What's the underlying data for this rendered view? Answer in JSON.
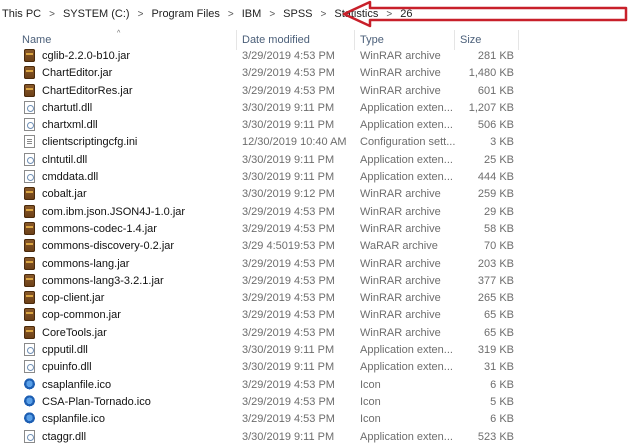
{
  "breadcrumb": [
    "This PC",
    "SYSTEM (C:)",
    "Program Files",
    "IBM",
    "SPSS",
    "Statistics",
    "26"
  ],
  "columns": {
    "name": "Name",
    "date": "Date modified",
    "type": "Type",
    "size": "Size"
  },
  "accent_color": "#c8202a",
  "files": [
    {
      "icon": "jar-file-icon",
      "name": "cglib-2.2.0-b10.jar",
      "date": "3/29/2019 4:53 PM",
      "type": "WinRAR archive",
      "size": "281 KB"
    },
    {
      "icon": "jar-file-icon",
      "name": "ChartEditor.jar",
      "date": "3/29/2019 4:53 PM",
      "type": "WinRAR archive",
      "size": "1,480 KB"
    },
    {
      "icon": "jar-file-icon",
      "name": "ChartEditorRes.jar",
      "date": "3/29/2019 4:53 PM",
      "type": "WinRAR archive",
      "size": "601 KB"
    },
    {
      "icon": "dll-file-icon",
      "name": "chartutl.dll",
      "date": "3/30/2019 9:11 PM",
      "type": "Application exten...",
      "size": "1,207 KB"
    },
    {
      "icon": "dll-file-icon",
      "name": "chartxml.dll",
      "date": "3/30/2019 9:11 PM",
      "type": "Application exten...",
      "size": "506 KB"
    },
    {
      "icon": "ini-file-icon",
      "name": "clientscriptingcfg.ini",
      "date": "12/30/2019 10:40 AM",
      "type": "Configuration sett...",
      "size": "3 KB"
    },
    {
      "icon": "dll-file-icon",
      "name": "clntutil.dll",
      "date": "3/30/2019 9:11 PM",
      "type": "Application exten...",
      "size": "25 KB"
    },
    {
      "icon": "dll-file-icon",
      "name": "cmddata.dll",
      "date": "3/30/2019 9:11 PM",
      "type": "Application exten...",
      "size": "444 KB"
    },
    {
      "icon": "jar-file-icon",
      "name": "cobalt.jar",
      "date": "3/30/2019 9:12 PM",
      "type": "WinRAR archive",
      "size": "259 KB"
    },
    {
      "icon": "jar-file-icon",
      "name": "com.ibm.json.JSON4J-1.0.jar",
      "date": "3/29/2019 4:53 PM",
      "type": "WinRAR archive",
      "size": "29 KB"
    },
    {
      "icon": "jar-file-icon",
      "name": "commons-codec-1.4.jar",
      "date": "3/29/2019 4:53 PM",
      "type": "WinRAR archive",
      "size": "58 KB"
    },
    {
      "icon": "jar-file-icon",
      "name": "commons-discovery-0.2.jar",
      "date": "3/29 4:5019:53 PM",
      "type": "WaRAR archive",
      "size": "70 KB"
    },
    {
      "icon": "jar-file-icon",
      "name": "commons-lang.jar",
      "date": "3/29/2019 4:53 PM",
      "type": "WinRAR archive",
      "size": "203 KB"
    },
    {
      "icon": "jar-file-icon",
      "name": "commons-lang3-3.2.1.jar",
      "date": "3/29/2019 4:53 PM",
      "type": "WinRAR archive",
      "size": "377 KB"
    },
    {
      "icon": "jar-file-icon",
      "name": "cop-client.jar",
      "date": "3/29/2019 4:53 PM",
      "type": "WinRAR archive",
      "size": "265 KB"
    },
    {
      "icon": "jar-file-icon",
      "name": "cop-common.jar",
      "date": "3/29/2019 4:53 PM",
      "type": "WinRAR archive",
      "size": "65 KB"
    },
    {
      "icon": "jar-file-icon",
      "name": "CoreTools.jar",
      "date": "3/29/2019 4:53 PM",
      "type": "WinRAR archive",
      "size": "65 KB"
    },
    {
      "icon": "dll-file-icon",
      "name": "cpputil.dll",
      "date": "3/30/2019 9:11 PM",
      "type": "Application exten...",
      "size": "319 KB"
    },
    {
      "icon": "dll-file-icon",
      "name": "cpuinfo.dll",
      "date": "3/30/2019 9:11 PM",
      "type": "Application exten...",
      "size": "31 KB"
    },
    {
      "icon": "ico-file-icon",
      "name": "csaplanfile.ico",
      "date": "3/29/2019 4:53 PM",
      "type": "Icon",
      "size": "6 KB"
    },
    {
      "icon": "ico-file-icon",
      "name": "CSA-Plan-Tornado.ico",
      "date": "3/29/2019 4:53 PM",
      "type": "Icon",
      "size": "5 KB"
    },
    {
      "icon": "ico-file-icon",
      "name": "csplanfile.ico",
      "date": "3/29/2019 4:53 PM",
      "type": "Icon",
      "size": "6 KB"
    },
    {
      "icon": "dll-file-icon",
      "name": "ctaggr.dll",
      "date": "3/30/2019 9:11 PM",
      "type": "Application exten...",
      "size": "523 KB"
    }
  ]
}
